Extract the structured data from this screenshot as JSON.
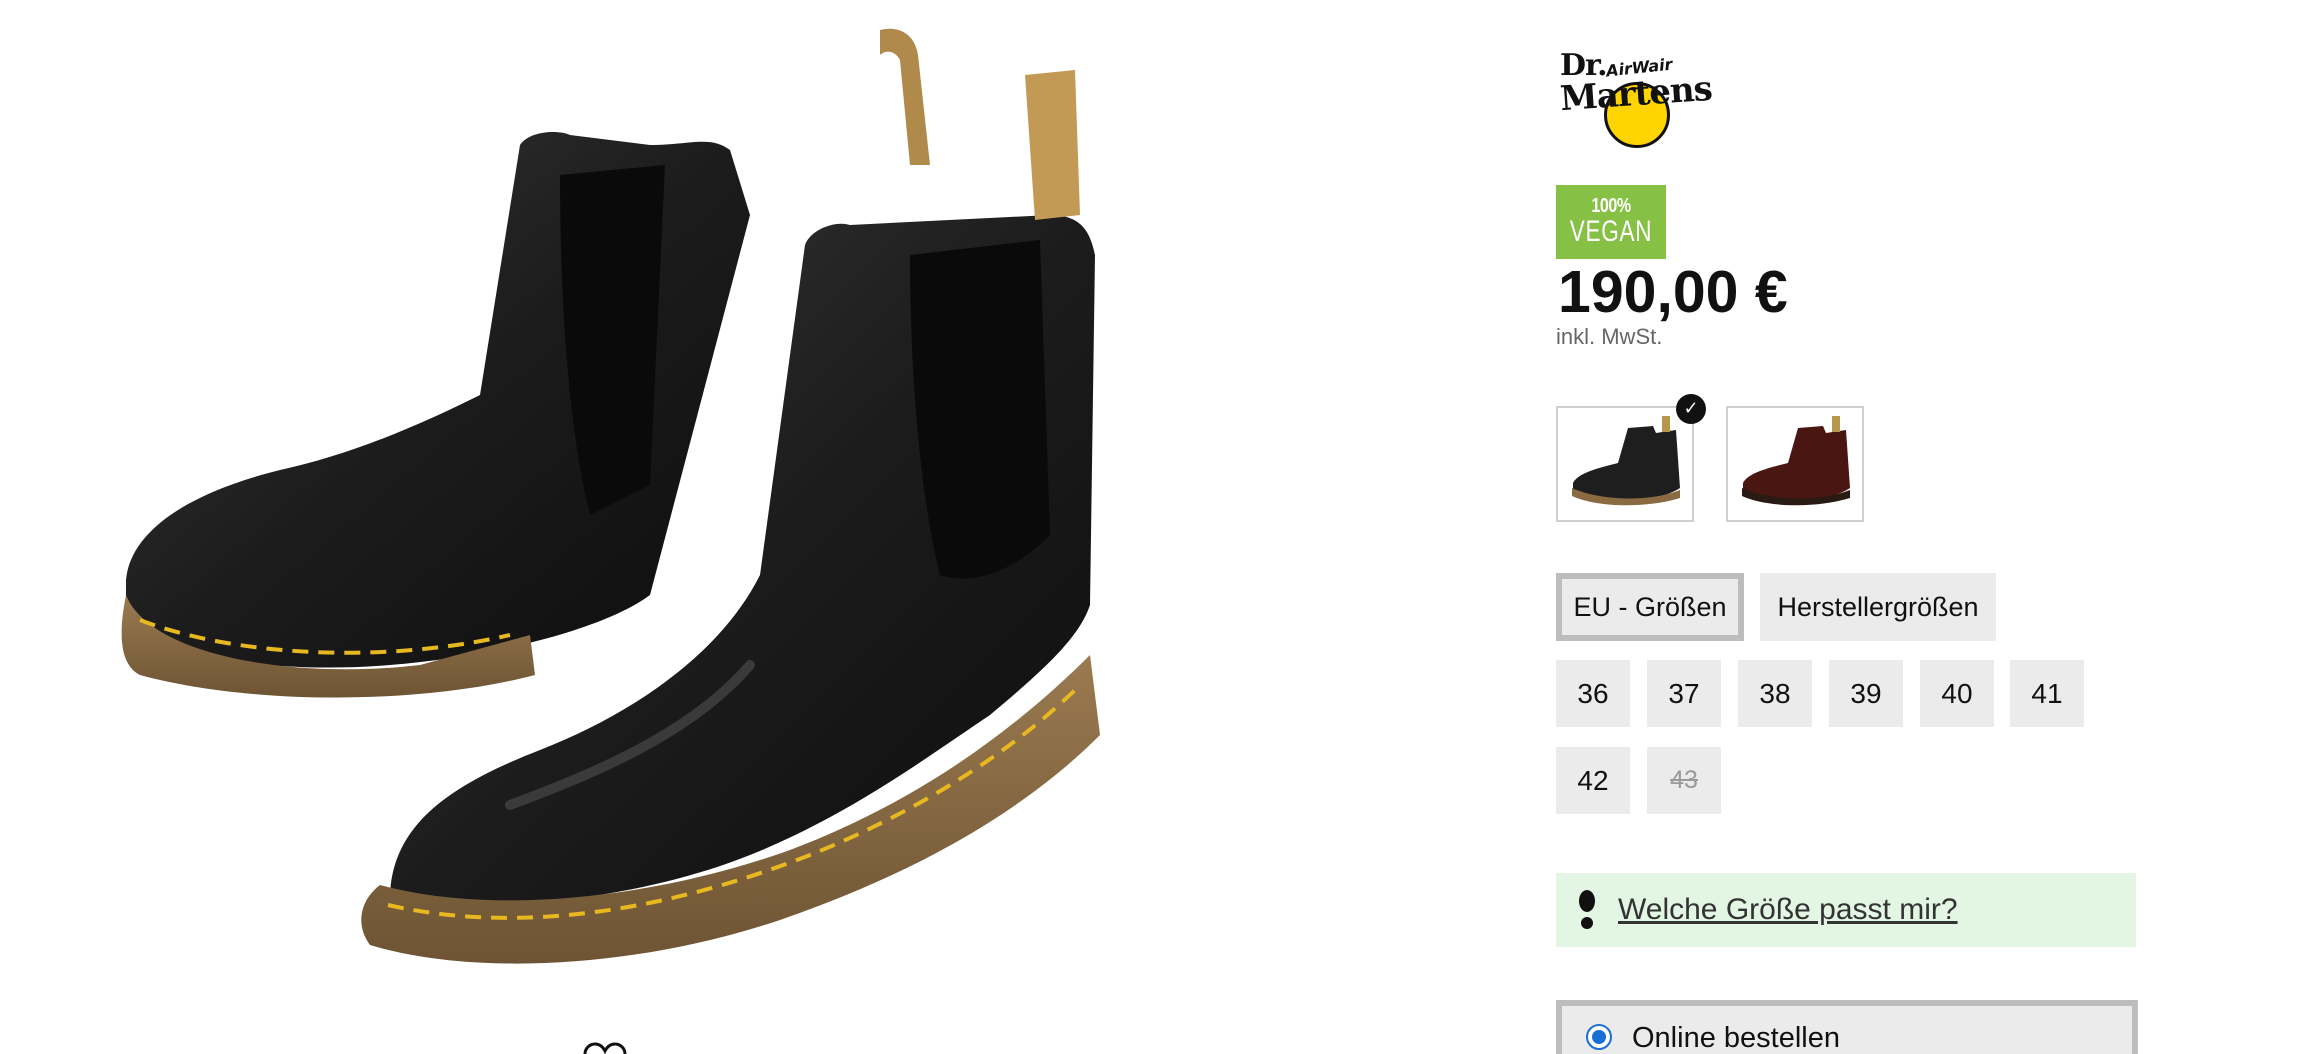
{
  "product": {
    "brand_logo": {
      "dr": "Dr.",
      "name": "Martens",
      "sub": "AirWair"
    },
    "badge": {
      "percent": "100%",
      "label": "VEGAN"
    },
    "price": "190,00 €",
    "vat_note": "inkl. MwSt."
  },
  "color_variants": [
    {
      "name": "black",
      "selected": true
    },
    {
      "name": "cherry-red",
      "selected": false
    }
  ],
  "size_tabs": [
    {
      "label": "EU - Größen",
      "active": true
    },
    {
      "label": "Herstellergrößen",
      "active": false
    }
  ],
  "sizes": [
    {
      "label": "36",
      "available": true
    },
    {
      "label": "37",
      "available": true
    },
    {
      "label": "38",
      "available": true
    },
    {
      "label": "39",
      "available": true
    },
    {
      "label": "40",
      "available": true
    },
    {
      "label": "41",
      "available": true
    },
    {
      "label": "42",
      "available": true
    },
    {
      "label": "43",
      "available": false
    }
  ],
  "fit_help": {
    "label": "Welche Größe passt mir?",
    "icon": "footprint-icon"
  },
  "order": {
    "option_label": "Online bestellen",
    "selected": true
  },
  "gallery": {
    "wishlist_icon": "heart-icon"
  },
  "colors": {
    "vegan_badge": "#86c045",
    "fit_box_bg": "#e3f5e3",
    "radio_accent": "#1a6fd6",
    "tile_bg": "#ebebeb"
  }
}
